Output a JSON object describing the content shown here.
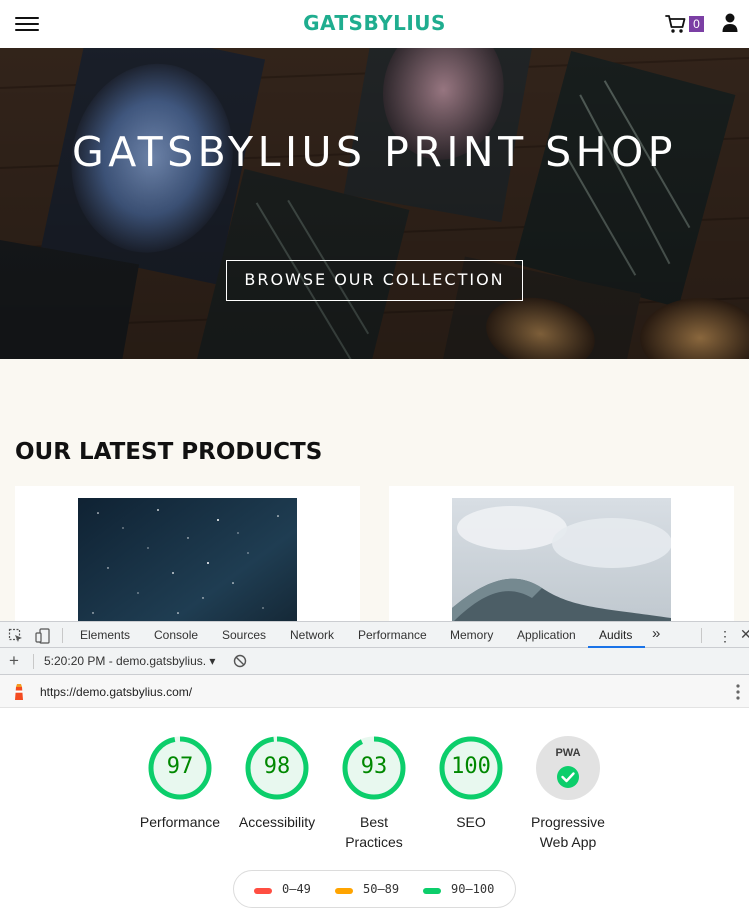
{
  "header": {
    "brand": "GATSBYLIUS",
    "brand_color": "#1fad8f",
    "cart_count": "0",
    "cart_badge_color": "#7b3fa4"
  },
  "hero": {
    "title": "GATSBYLIUS PRINT SHOP",
    "button": "BROWSE OUR COLLECTION"
  },
  "products": {
    "title": "OUR LATEST PRODUCTS"
  },
  "devtools": {
    "tabs": [
      "Elements",
      "Console",
      "Sources",
      "Network",
      "Performance",
      "Memory",
      "Application",
      "Audits"
    ],
    "active_tab": "Audits",
    "report_selector": "5:20:20 PM - demo.gatsbylius. ▾",
    "url": "https://demo.gatsbylius.com/"
  },
  "audits": {
    "gauges": [
      {
        "score": "97",
        "label": "Performance"
      },
      {
        "score": "98",
        "label": "Accessibility"
      },
      {
        "score": "93",
        "label": "Best Practices"
      },
      {
        "score": "100",
        "label": "SEO"
      }
    ],
    "pwa": {
      "badge": "PWA",
      "label": "Progressive Web App"
    },
    "pass_color": "#0cce6b",
    "pass_fill": "#e8f8ef",
    "score_text_color": "#008800",
    "legend": [
      {
        "range": "0–49",
        "color": "#ff4e42"
      },
      {
        "range": "50–89",
        "color": "#ffa400"
      },
      {
        "range": "90–100",
        "color": "#0cce6b"
      }
    ]
  }
}
